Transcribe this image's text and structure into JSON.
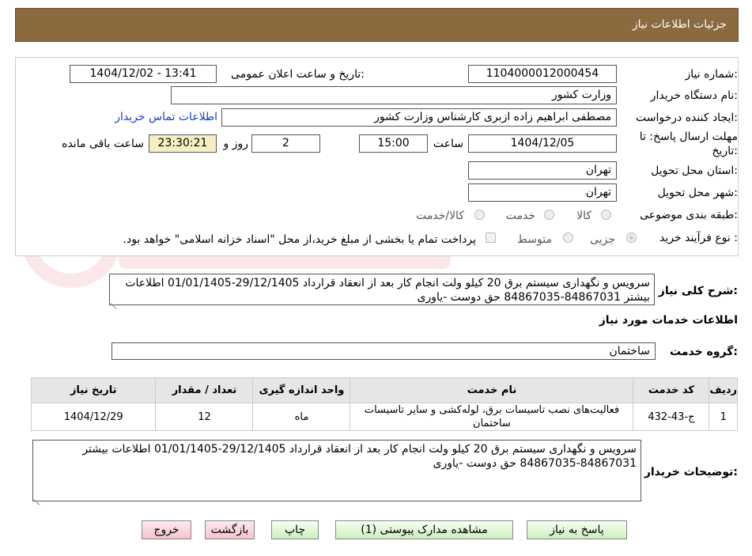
{
  "header": {
    "title": "جزئیات اطلاعات نیاز"
  },
  "fields": {
    "need_number_label": "شماره نیاز:",
    "need_number": "1104000012000454",
    "announce_label": "تاریخ و ساعت اعلان عمومی:",
    "announce_value": "1404/12/02 - 13:41",
    "buyer_org_label": "نام دستگاه خریدار:",
    "buyer_org": "وزارت کشور",
    "creator_label": "ایجاد کننده درخواست:",
    "creator": "مصطفی ابراهیم زاده ازبری کارشناس وزارت کشور",
    "contact_link": "اطلاعات تماس خریدار",
    "deadline_label_1": "مهلت ارسال پاسخ: تا",
    "deadline_label_2": "تاریخ:",
    "deadline_date": "1404/12/05",
    "time_label": "ساعت",
    "deadline_time": "15:00",
    "days": "2",
    "days_label": "روز و",
    "remaining_time": "23:30:21",
    "remaining_label": "ساعت باقی مانده",
    "province_label": "استان محل تحویل:",
    "province": "تهران",
    "city_label": "شهر محل تحویل:",
    "city": "تهران",
    "category_label": "طبقه بندی موضوعی:",
    "category_options": [
      "کالا",
      "خدمت",
      "کالا/خدمت"
    ],
    "process_label": "نوع فرآیند خرید :",
    "process_options": [
      "جزیی",
      "متوسط"
    ],
    "payment_note": "پرداخت تمام یا بخشی از مبلغ خرید،از محل \"اسناد خزانه اسلامی\" خواهد بود.",
    "summary_label": "شرح کلی نیاز:",
    "summary": "سرویس و نگهداری سیستم برق 20 کیلو ولت انجام کار بعد از انعقاد قرارداد 29/12/1405-01/01/1405 اطلاعات بیشتر 84867031-84867035 حق دوست -یاوری",
    "services_title": "اطلاعات خدمات مورد نیاز",
    "service_group_label": "گروه خدمت:",
    "service_group": "ساختمان"
  },
  "table": {
    "headers": [
      "ردیف",
      "کد خدمت",
      "نام خدمت",
      "واحد اندازه گیری",
      "تعداد / مقدار",
      "تاریخ نیاز"
    ],
    "rows": [
      [
        "1",
        "ج-43-432",
        "فعالیت‌های نصب تاسیسات برق، لوله‌کشی و سایر تاسیسات ساختمان",
        "ماه",
        "12",
        "1404/12/29"
      ]
    ]
  },
  "buyer_notes_label": "توضیحات خریدار:",
  "buyer_notes": "سرویس و نگهداری سیستم برق 20 کیلو ولت انجام کار بعد از انعقاد قرارداد 29/12/1405-01/01/1405 اطلاعات بیشتر 84867031-84867035 حق دوست -یاوری",
  "buttons": {
    "reply": "پاسخ به نیاز",
    "attachments": "مشاهده مدارک پیوستی (1)",
    "print": "چاپ",
    "back": "بازگشت",
    "exit": "خروج"
  },
  "colors": {
    "header_bg": "#8B6A3F",
    "link": "#1a3ec6",
    "button_green": "#cfeec0",
    "button_red": "#f6c3cf"
  }
}
